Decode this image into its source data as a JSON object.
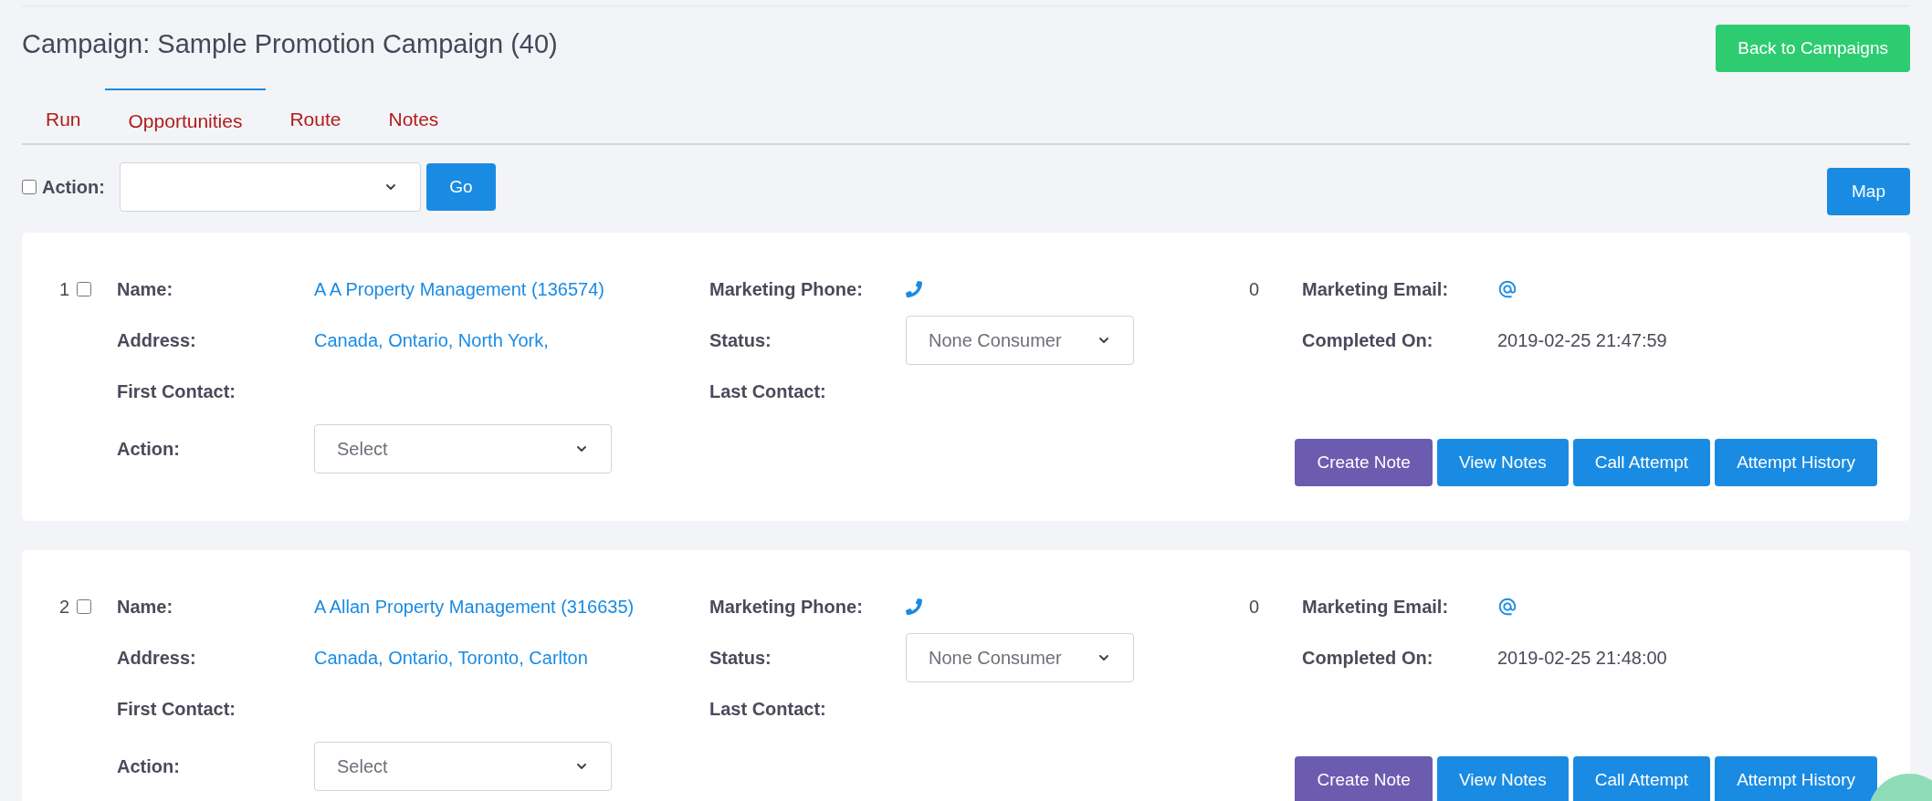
{
  "title": "Campaign: Sample Promotion Campaign (40)",
  "back_button": "Back to Campaigns",
  "tabs": [
    {
      "label": "Run",
      "selected": false
    },
    {
      "label": "Opportunities",
      "selected": true
    },
    {
      "label": "Route",
      "selected": false
    },
    {
      "label": "Notes",
      "selected": false
    }
  ],
  "bulk_action": {
    "checked": false,
    "label": "Action:"
  },
  "go_button": "Go",
  "map_button": "Map",
  "records": [
    {
      "index": "1",
      "checked": false,
      "name_label": "Name:",
      "name": "A A Property Management (136574)",
      "address_label": "Address:",
      "address": "Canada, Ontario, North York,",
      "first_contact_label": "First Contact:",
      "phone_label": "Marketing Phone:",
      "status_label": "Status:",
      "status": "None Consumer",
      "last_contact_label": "Last Contact:",
      "count": "0",
      "email_label": "Marketing Email:",
      "completed_label": "Completed On:",
      "completed_on": "2019-02-25 21:47:59",
      "action_label": "Action:",
      "action_value": "Select",
      "buttons": [
        {
          "label": "Create Note",
          "color": "#6c5cb0"
        },
        {
          "label": "View Notes",
          "color": "#1a8be3"
        },
        {
          "label": "Call Attempt",
          "color": "#1a8be3"
        },
        {
          "label": "Attempt History",
          "color": "#1a8be3"
        }
      ]
    },
    {
      "index": "2",
      "checked": false,
      "name_label": "Name:",
      "name": "A Allan Property Management (316635)",
      "address_label": "Address:",
      "address": "Canada, Ontario, Toronto, Carlton",
      "first_contact_label": "First Contact:",
      "phone_label": "Marketing Phone:",
      "status_label": "Status:",
      "status": "None Consumer",
      "last_contact_label": "Last Contact:",
      "count": "0",
      "email_label": "Marketing Email:",
      "completed_label": "Completed On:",
      "completed_on": "2019-02-25 21:48:00",
      "action_label": "Action:",
      "action_value": "Select",
      "buttons": [
        {
          "label": "Create Note",
          "color": "#6c5cb0"
        },
        {
          "label": "View Notes",
          "color": "#1a8be3"
        },
        {
          "label": "Call Attempt",
          "color": "#1a8be3"
        },
        {
          "label": "Attempt History",
          "color": "#1a8be3"
        }
      ]
    }
  ]
}
